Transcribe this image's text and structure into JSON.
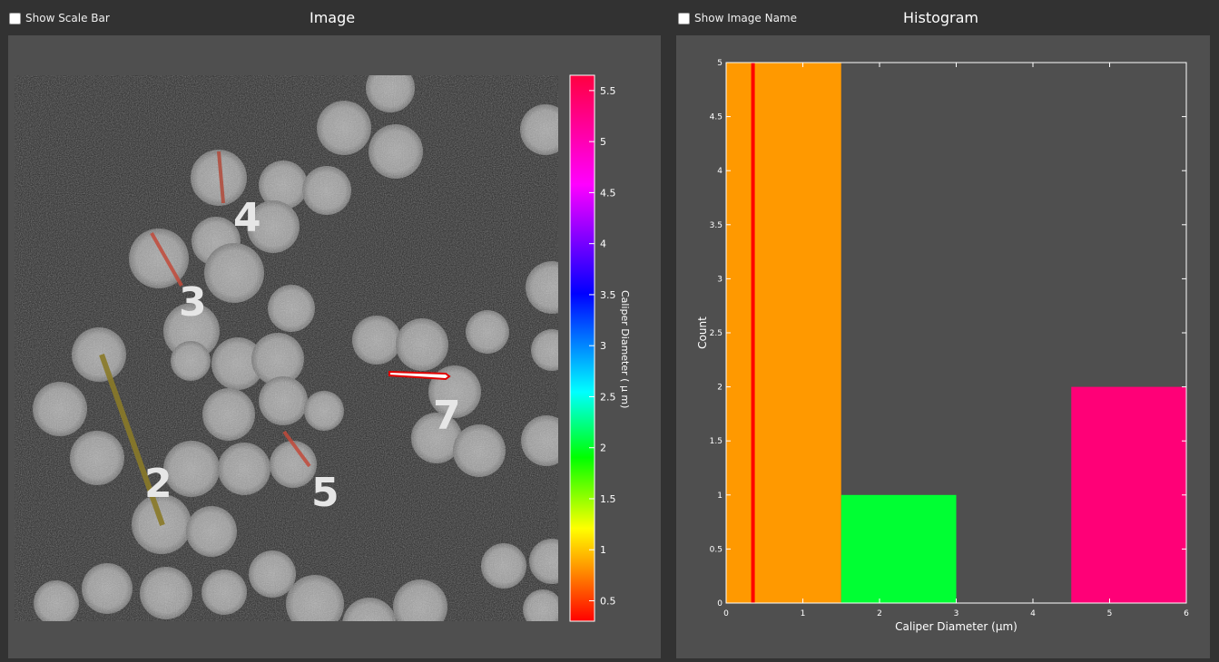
{
  "image_pane": {
    "checkbox_label": "Show Scale Bar",
    "checked": false,
    "title": "Image",
    "particle_labels": [
      "4",
      "3",
      "7",
      "2",
      "5"
    ],
    "colorbar": {
      "label": "Caliper Diameter ( μ m)",
      "ticks": [
        "5.5",
        "5",
        "4.5",
        "4",
        "3.5",
        "3",
        "2.5",
        "2",
        "1.5",
        "1",
        "0.5"
      ],
      "range": [
        0.3,
        5.65
      ]
    }
  },
  "histogram_pane": {
    "checkbox_label": "Show Image Name",
    "checked": false,
    "title": "Histogram"
  },
  "chart_data": {
    "type": "bar",
    "xlabel": "Caliper Diameter (μm)",
    "ylabel": "Count",
    "xlim": [
      0,
      6
    ],
    "ylim": [
      0,
      5
    ],
    "x_ticks": [
      "0",
      "1",
      "2",
      "3",
      "4",
      "5",
      "6"
    ],
    "y_ticks": [
      "0",
      "0.5",
      "1",
      "1.5",
      "2",
      "2.5",
      "3",
      "3.5",
      "4",
      "4.5",
      "5"
    ],
    "bins": [
      {
        "x0": 0,
        "x1": 1.5,
        "count": 5,
        "color": "#ff9900"
      },
      {
        "x0": 1.5,
        "x1": 3,
        "count": 1,
        "color": "#00ff33"
      },
      {
        "x0": 3,
        "x1": 4.5,
        "count": 0,
        "color": "#4f4f4f"
      },
      {
        "x0": 4.5,
        "x1": 6,
        "count": 2,
        "color": "#ff0077"
      }
    ],
    "marker_line": {
      "x": 0.35,
      "color": "#ff0000"
    }
  },
  "colors": {
    "window_bg": "#323232",
    "panel_bg": "#4f4f4f",
    "text": "#ffffff"
  }
}
